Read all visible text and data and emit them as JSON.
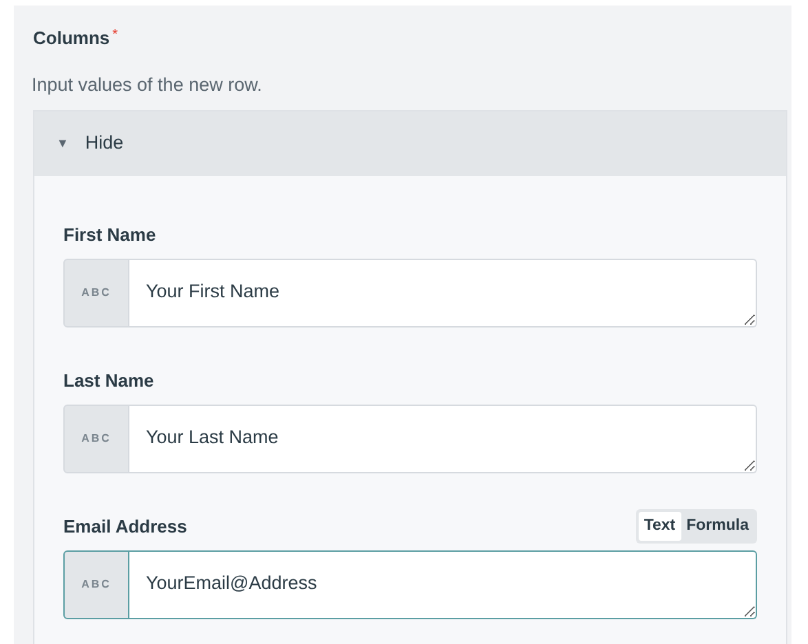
{
  "section": {
    "title": "Columns",
    "required_mark": "*",
    "description": "Input values of the new row."
  },
  "collapse": {
    "icon": "▼",
    "label": "Hide",
    "expanded": true
  },
  "fields": [
    {
      "label": "First Name",
      "type_badge": "ABC",
      "value": "Your First Name",
      "focused": false
    },
    {
      "label": "Last Name",
      "type_badge": "ABC",
      "value": "Your Last Name",
      "focused": false
    },
    {
      "label": "Email Address",
      "type_badge": "ABC",
      "value": "YourEmail@Address",
      "focused": true,
      "modes": [
        {
          "label": "Text",
          "selected": true
        },
        {
          "label": "Formula",
          "selected": false
        }
      ]
    }
  ]
}
